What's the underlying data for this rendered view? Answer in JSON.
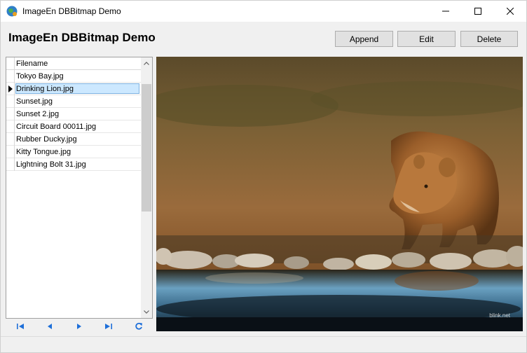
{
  "window": {
    "title": "ImageEn DBBitmap Demo",
    "icon": "globe-app-icon"
  },
  "header": {
    "title": "ImageEn DBBitmap Demo",
    "append_label": "Append",
    "edit_label": "Edit",
    "delete_label": "Delete"
  },
  "grid": {
    "column_header": "Filename",
    "selected_index": 1,
    "rows": [
      "Tokyo Bay.jpg",
      "Drinking Lion.jpg",
      "Sunset.jpg",
      "Sunset 2.jpg",
      "Circuit Board 00011.jpg",
      "Rubber Ducky.jpg",
      "Kitty Tongue.jpg",
      "Lightning Bolt 31.jpg"
    ]
  },
  "navigator": {
    "buttons": [
      "first-icon",
      "prior-icon",
      "next-icon",
      "last-icon",
      "refresh-icon"
    ],
    "accent": "#1e6fd9"
  },
  "image": {
    "subject": "lioness drinking at water",
    "watermark": "blink.net"
  }
}
